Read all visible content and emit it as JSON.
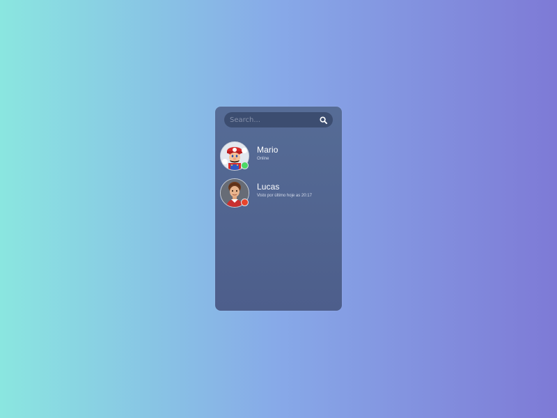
{
  "search": {
    "placeholder": "Search...",
    "icon": "search-icon"
  },
  "contacts": [
    {
      "name": "Mario",
      "status_text": "Online",
      "status_color": "#4cd964",
      "avatar_icon": "mario-avatar"
    },
    {
      "name": "Lucas",
      "status_text": "Visto por último hoje as 20:17",
      "status_color": "#e8452c",
      "avatar_icon": "lucas-avatar"
    }
  ]
}
